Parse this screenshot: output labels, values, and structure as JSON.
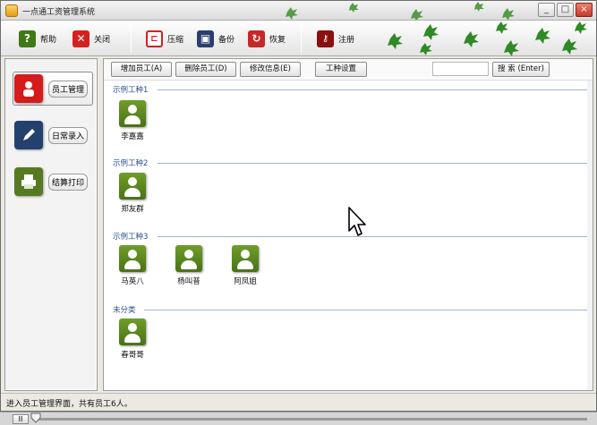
{
  "window": {
    "title": "一点通工资管理系统",
    "buttons": [
      "_",
      "□",
      "×"
    ]
  },
  "toolbar": {
    "items": [
      {
        "label": "帮助",
        "icon": "help-icon",
        "color": "#3f7a16"
      },
      {
        "label": "关闭",
        "icon": "close-icon",
        "color": "#d52020"
      },
      {
        "label": "压缩",
        "icon": "compress-icon",
        "color": "#d52020"
      },
      {
        "label": "备份",
        "icon": "backup-icon",
        "color": "#2a3f6f"
      },
      {
        "label": "恢复",
        "icon": "restore-icon",
        "color": "#c62828"
      },
      {
        "label": "注册",
        "icon": "key-icon",
        "color": "#8b1010"
      }
    ]
  },
  "nav": {
    "items": [
      {
        "label": "员工管理",
        "icon": "person-icon",
        "color": "#d51b1b",
        "active": true
      },
      {
        "label": "日常录入",
        "icon": "pen-icon",
        "color": "#23406f",
        "active": false
      },
      {
        "label": "结算打印",
        "icon": "printer-icon",
        "color": "#557a22",
        "active": false
      }
    ]
  },
  "content_toolbar": {
    "add": "增加员工(A)",
    "delete": "删除员工(D)",
    "edit": "修改信息(E)",
    "worktype": "工种设置",
    "search_value": "",
    "search": "搜 索 (Enter)"
  },
  "groups": [
    {
      "title": "示例工种1",
      "employees": [
        "李嘉嘉"
      ]
    },
    {
      "title": "示例工种2",
      "employees": [
        "郑友群"
      ]
    },
    {
      "title": "示例工种3",
      "employees": [
        "马英八",
        "杨叫普",
        "阿凤姐"
      ]
    },
    {
      "title": "未分类",
      "employees": [
        "春哥哥"
      ]
    }
  ],
  "status": {
    "text": "进入员工管理界面，共有员工6人。"
  },
  "player": {
    "pause": "II"
  }
}
